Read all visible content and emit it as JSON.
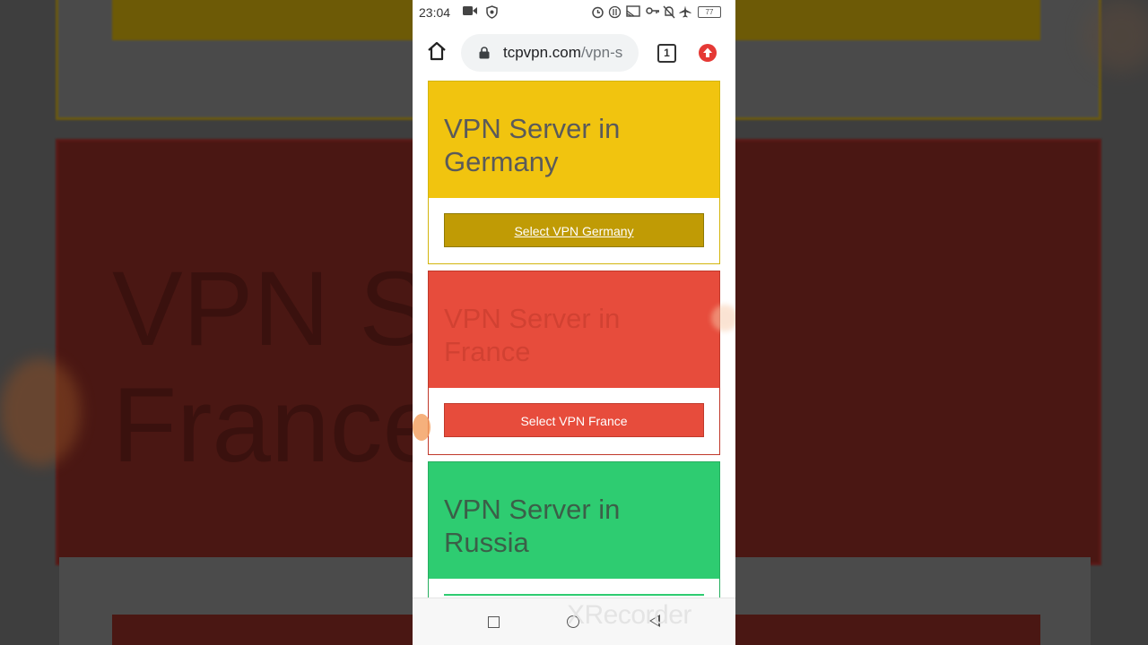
{
  "status_bar": {
    "time": "23:04",
    "battery": "77"
  },
  "browser": {
    "url_host": "tcpvpn.com",
    "url_path": "/vpn-s",
    "tab_count": "1"
  },
  "cards": [
    {
      "title_line1": "VPN Server in",
      "title_line2": "Germany",
      "button": "Select VPN Germany",
      "color": "#f1c40f"
    },
    {
      "title_line1": "VPN Server in",
      "title_line2": "France",
      "button": "Select VPN France",
      "color": "#e74c3c"
    },
    {
      "title_line1": "VPN Server in",
      "title_line2": "Russia",
      "button": "",
      "color": "#2ecc71"
    }
  ],
  "background": {
    "ghost_line1": "VPN S      n",
    "ghost_line2": "France"
  },
  "watermark": "XRecorder",
  "icons": {
    "home": "home-icon",
    "lock": "lock-icon",
    "tabs": "tab-switcher-icon",
    "update": "chrome-update-icon",
    "nav_recents": "recents-icon",
    "nav_home": "nav-home-icon",
    "nav_back": "back-icon"
  }
}
